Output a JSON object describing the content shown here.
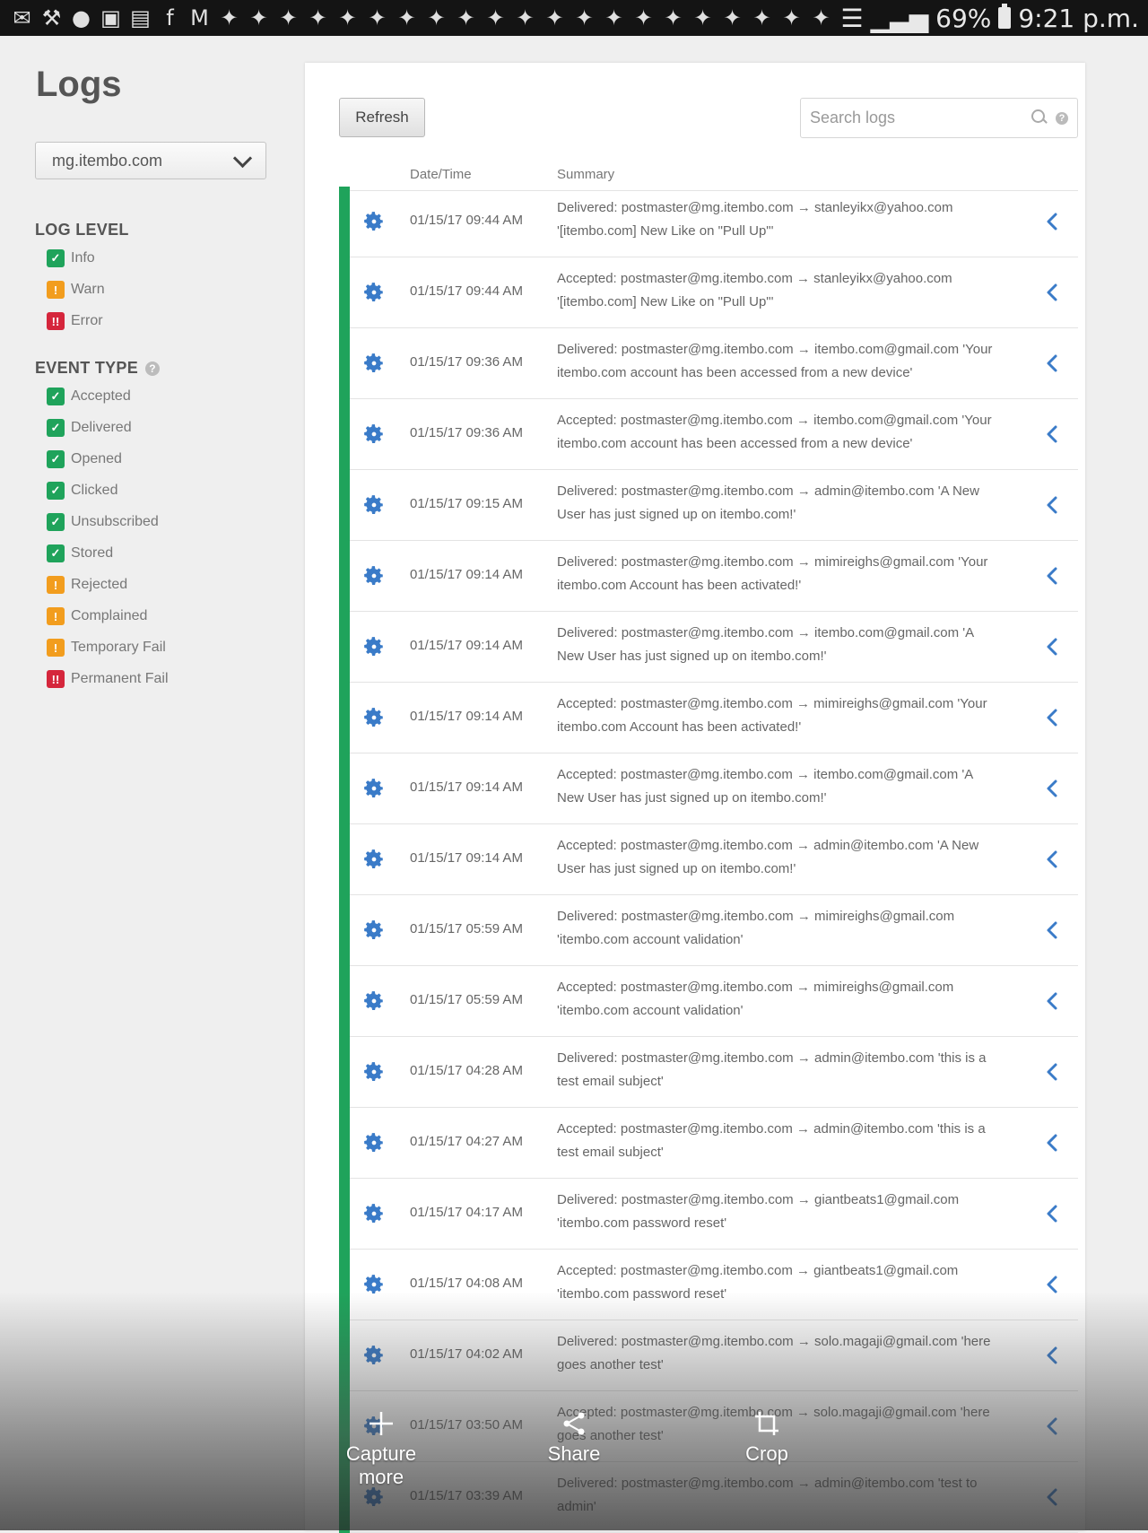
{
  "status_bar": {
    "notification_icons": [
      "message-icon",
      "wrench-icon",
      "messenger-icon",
      "gallery-icon",
      "chat-icon",
      "facebook-icon",
      "gmail-icon",
      "twitter-icon",
      "twitter-icon",
      "twitter-icon",
      "twitter-icon",
      "twitter-icon",
      "twitter-icon",
      "twitter-icon",
      "twitter-icon",
      "twitter-icon",
      "twitter-icon",
      "twitter-icon",
      "twitter-icon",
      "twitter-icon",
      "twitter-icon",
      "twitter-icon",
      "twitter-icon",
      "twitter-icon",
      "twitter-icon",
      "twitter-icon",
      "twitter-icon",
      "twitter-icon"
    ],
    "battery": "69%",
    "time": "9:21 p.m."
  },
  "sidebar": {
    "title": "Logs",
    "domain_selected": "mg.itembo.com",
    "log_level": {
      "heading": "LOG LEVEL",
      "items": [
        {
          "label": "Info",
          "type": "check"
        },
        {
          "label": "Warn",
          "type": "warn"
        },
        {
          "label": "Error",
          "type": "error"
        }
      ]
    },
    "event_type": {
      "heading": "EVENT TYPE",
      "items": [
        {
          "label": "Accepted",
          "type": "check"
        },
        {
          "label": "Delivered",
          "type": "check"
        },
        {
          "label": "Opened",
          "type": "check"
        },
        {
          "label": "Clicked",
          "type": "check"
        },
        {
          "label": "Unsubscribed",
          "type": "check"
        },
        {
          "label": "Stored",
          "type": "check"
        },
        {
          "label": "Rejected",
          "type": "warn"
        },
        {
          "label": "Complained",
          "type": "warn"
        },
        {
          "label": "Temporary Fail",
          "type": "warn"
        },
        {
          "label": "Permanent Fail",
          "type": "error"
        }
      ]
    }
  },
  "toolbar": {
    "refresh_label": "Refresh",
    "search_placeholder": "Search logs"
  },
  "table": {
    "headers": {
      "datetime": "Date/Time",
      "summary": "Summary"
    },
    "rows": [
      {
        "datetime": "01/15/17 09:44 AM",
        "summary": "Delivered: postmaster@mg.itembo.com → stanleyikx@yahoo.com '[itembo.com] New Like on \"Pull Up\"'"
      },
      {
        "datetime": "01/15/17 09:44 AM",
        "summary": "Accepted: postmaster@mg.itembo.com → stanleyikx@yahoo.com '[itembo.com] New Like on \"Pull Up\"'"
      },
      {
        "datetime": "01/15/17 09:36 AM",
        "summary": "Delivered: postmaster@mg.itembo.com → itembo.com@gmail.com 'Your itembo.com account has been accessed from a new device'"
      },
      {
        "datetime": "01/15/17 09:36 AM",
        "summary": "Accepted: postmaster@mg.itembo.com → itembo.com@gmail.com 'Your itembo.com account has been accessed from a new device'"
      },
      {
        "datetime": "01/15/17 09:15 AM",
        "summary": "Delivered: postmaster@mg.itembo.com → admin@itembo.com 'A New User has just signed up on itembo.com!'"
      },
      {
        "datetime": "01/15/17 09:14 AM",
        "summary": "Delivered: postmaster@mg.itembo.com → mimireighs@gmail.com 'Your itembo.com Account has been activated!'"
      },
      {
        "datetime": "01/15/17 09:14 AM",
        "summary": "Delivered: postmaster@mg.itembo.com → itembo.com@gmail.com 'A New User has just signed up on itembo.com!'"
      },
      {
        "datetime": "01/15/17 09:14 AM",
        "summary": "Accepted: postmaster@mg.itembo.com → mimireighs@gmail.com 'Your itembo.com Account has been activated!'"
      },
      {
        "datetime": "01/15/17 09:14 AM",
        "summary": "Accepted: postmaster@mg.itembo.com → itembo.com@gmail.com 'A New User has just signed up on itembo.com!'"
      },
      {
        "datetime": "01/15/17 09:14 AM",
        "summary": "Accepted: postmaster@mg.itembo.com → admin@itembo.com 'A New User has just signed up on itembo.com!'"
      },
      {
        "datetime": "01/15/17 05:59 AM",
        "summary": "Delivered: postmaster@mg.itembo.com → mimireighs@gmail.com 'itembo.com account validation'"
      },
      {
        "datetime": "01/15/17 05:59 AM",
        "summary": "Accepted: postmaster@mg.itembo.com → mimireighs@gmail.com 'itembo.com account validation'"
      },
      {
        "datetime": "01/15/17 04:28 AM",
        "summary": "Delivered: postmaster@mg.itembo.com → admin@itembo.com 'this is a test email subject'"
      },
      {
        "datetime": "01/15/17 04:27 AM",
        "summary": "Accepted: postmaster@mg.itembo.com → admin@itembo.com 'this is a test email subject'"
      },
      {
        "datetime": "01/15/17 04:17 AM",
        "summary": "Delivered: postmaster@mg.itembo.com → giantbeats1@gmail.com 'itembo.com password reset'"
      },
      {
        "datetime": "01/15/17 04:08 AM",
        "summary": "Accepted: postmaster@mg.itembo.com → giantbeats1@gmail.com 'itembo.com password reset'"
      },
      {
        "datetime": "01/15/17 04:02 AM",
        "summary": "Delivered: postmaster@mg.itembo.com → solo.magaji@gmail.com 'here goes another test'"
      },
      {
        "datetime": "01/15/17 03:50 AM",
        "summary": "Accepted: postmaster@mg.itembo.com → solo.magaji@gmail.com 'here goes another test'"
      },
      {
        "datetime": "01/15/17 03:39 AM",
        "summary": "Delivered: postmaster@mg.itembo.com → admin@itembo.com 'test to admin'"
      }
    ]
  },
  "capture_bar": {
    "capture_more": "Capture more",
    "share": "Share",
    "crop": "Crop"
  },
  "colors": {
    "success": "#1fa35b",
    "warning": "#f29d1e",
    "error": "#d5263c",
    "accent_blue": "#3a7bc8"
  }
}
